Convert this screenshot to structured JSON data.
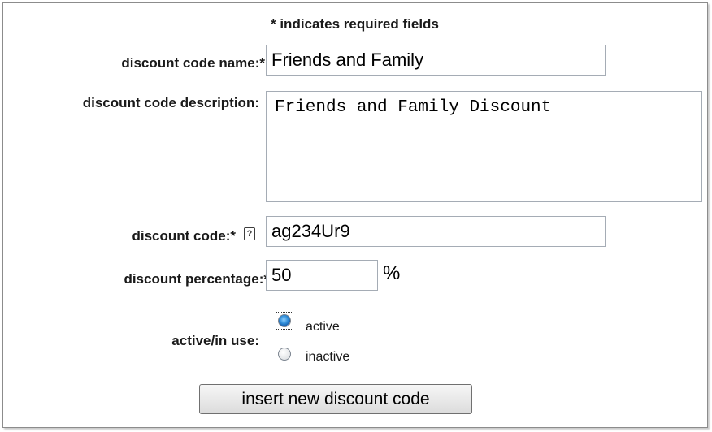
{
  "form": {
    "required_note": "* indicates required fields",
    "name_label": "discount code name:*",
    "name_value": "Friends and Family",
    "description_label": "discount code description:",
    "description_value": "Friends and Family Discount",
    "code_label": "discount code:*",
    "help_glyph": "?",
    "code_value": "ag234Ur9",
    "percentage_label": "discount percentage:*",
    "percentage_value": "50",
    "percent_sign": "%",
    "active_label": "active/in use:",
    "active_option": "active",
    "inactive_option": "inactive",
    "active_selected": true,
    "submit_label": "insert new discount code"
  },
  "icons": {
    "help": "help-icon"
  }
}
